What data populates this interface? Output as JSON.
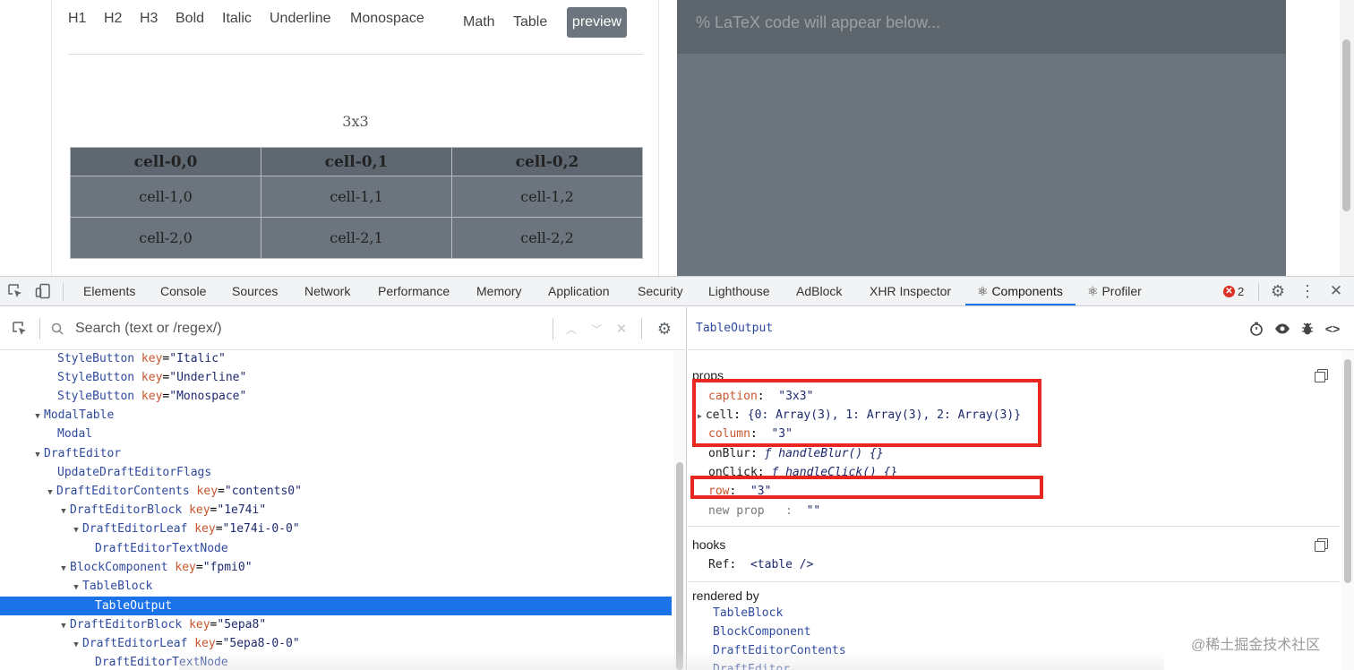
{
  "editor": {
    "style_buttons": [
      "H1",
      "H2",
      "H3",
      "Bold",
      "Italic",
      "Underline",
      "Monospace",
      "Math",
      "Table"
    ],
    "preview_label": "preview",
    "table_caption": "3x3",
    "table_rows": [
      [
        "cell-0,0",
        "cell-0,1",
        "cell-0,2"
      ],
      [
        "cell-1,0",
        "cell-1,1",
        "cell-1,2"
      ],
      [
        "cell-2,0",
        "cell-2,1",
        "cell-2,2"
      ]
    ]
  },
  "latex": {
    "placeholder": "% LaTeX code will appear below..."
  },
  "devtools": {
    "tabs": [
      "Elements",
      "Console",
      "Sources",
      "Network",
      "Performance",
      "Memory",
      "Application",
      "Security",
      "Lighthouse",
      "AdBlock",
      "XHR Inspector",
      "⚛ Components",
      "⚛ Profiler"
    ],
    "active_tab": "⚛ Components",
    "error_count": "2",
    "search_placeholder": "Search (text or /regex/)",
    "tree": [
      {
        "name": "StyleButton",
        "key": "Italic"
      },
      {
        "name": "StyleButton",
        "key": "Underline"
      },
      {
        "name": "StyleButton",
        "key": "Monospace"
      },
      {
        "name": "ModalTable"
      },
      {
        "name": "Modal"
      },
      {
        "name": "DraftEditor"
      },
      {
        "name": "UpdateDraftEditorFlags"
      },
      {
        "name": "DraftEditorContents",
        "key": "contents0"
      },
      {
        "name": "DraftEditorBlock",
        "key": "1e74i"
      },
      {
        "name": "DraftEditorLeaf",
        "key": "1e74i-0-0"
      },
      {
        "name": "DraftEditorTextNode"
      },
      {
        "name": "BlockComponent",
        "key": "fpmi0"
      },
      {
        "name": "TableBlock"
      },
      {
        "name": "TableOutput"
      },
      {
        "name": "DraftEditorBlock",
        "key": "5epa8"
      },
      {
        "name": "DraftEditorLeaf",
        "key": "5epa8-0-0"
      },
      {
        "name": "DraftEditorTextNode"
      }
    ],
    "selected_component": "TableOutput",
    "props_label": "props",
    "props": {
      "caption_key": "caption",
      "caption_val": "\"3x3\"",
      "cell_key": "cell",
      "cell_val": "{0: Array(3), 1: Array(3), 2: Array(3)}",
      "column_key": "column",
      "column_val": "\"3\"",
      "onblur_key": "onBlur",
      "onblur_val": "ƒ handleBlur() {}",
      "onclick_key": "onClick",
      "onclick_val": "ƒ handleClick() {}",
      "row_key": "row",
      "row_val": "\"3\"",
      "new_prop_key": "new prop",
      "new_prop_val": "\"\""
    },
    "hooks_label": "hooks",
    "hooks": {
      "ref_key": "Ref",
      "ref_val": "<table />"
    },
    "rendered_by_label": "rendered by",
    "rendered_by": [
      "TableBlock",
      "BlockComponent",
      "DraftEditorContents",
      "DraftEditor"
    ]
  },
  "watermark": "@稀土掘金技术社区",
  "colors": {
    "highlight_box": "#e8271f",
    "selected_row": "#1a73e8",
    "preview_button": "#6c757d"
  }
}
